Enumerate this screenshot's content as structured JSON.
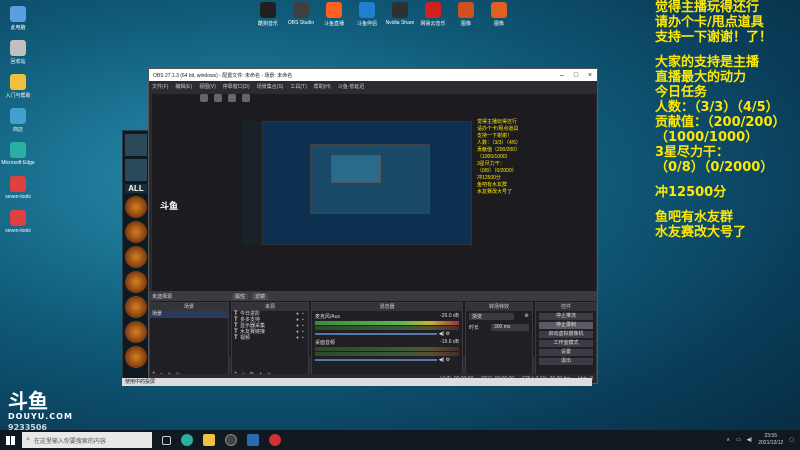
{
  "desktop": {
    "left_icons": [
      {
        "label": "此电脑",
        "color": "#5aa0e0"
      },
      {
        "label": "回收站",
        "color": "#c0c0c0"
      },
      {
        "label": "入门与帮助",
        "color": "#f0c040"
      },
      {
        "label": "商店",
        "color": "#40a0d0"
      },
      {
        "label": "Microsoft Edge",
        "color": "#2ab0a0"
      },
      {
        "label": "seven-tools",
        "color": "#e04040"
      },
      {
        "label": "seven-tools",
        "color": "#e04040"
      }
    ],
    "top_icons": [
      {
        "label": "酷狗音乐",
        "color": "#202020"
      },
      {
        "label": "OBS Studio",
        "color": "#404040"
      },
      {
        "label": "斗鱼直播",
        "color": "#ff6020"
      },
      {
        "label": "斗鱼伴侣",
        "color": "#2080d0"
      },
      {
        "label": "Nvidia Share",
        "color": "#303030"
      },
      {
        "label": "网易云音乐",
        "color": "#d02020"
      },
      {
        "label": "图像",
        "color": "#d05020"
      },
      {
        "label": "图像",
        "color": "#e06020"
      }
    ]
  },
  "overlay": {
    "lines": [
      "觉得主播玩得还行",
      "请办个卡/甩点道具",
      "支持一下谢谢！了！"
    ],
    "lines2": [
      "大家的支持是主播",
      "直播最大的动力",
      "今日任务",
      "人数：（3/3）（4/5）",
      "贡献值：（200/200）",
      "（1000/1000）",
      "3星尽力干：",
      "（0/8）（0/2000）"
    ],
    "line_chong": "冲12500分",
    "lines3": [
      "鱼吧有水友群",
      "水友赛改大号了"
    ]
  },
  "obs": {
    "title": "OBS 27.1.3 (64 bit, windows) - 配置文件: 未命名 - 场景: 未命名",
    "menu": [
      "文件(F)",
      "编辑(E)",
      "视图(V)",
      "停靠窗口(D)",
      "场景集合(S)",
      "工具(T)",
      "帮助(H)",
      "斗鱼-低延迟"
    ],
    "no_source": "未选择源",
    "props_label": "属性",
    "filters_label": "滤镜",
    "scenes_header": "场景",
    "scene_item": "场景",
    "sources_header": "来源",
    "sources": [
      "今日进阶",
      "多多支持",
      "显示器采集",
      "水友赛链接",
      "视频"
    ],
    "mixer_header": "混音器",
    "mixer": [
      {
        "name": "麦克风/Aux",
        "db": "-26.0 dB"
      },
      {
        "name": "桌面音频",
        "db": "-19.6 dB"
      }
    ],
    "transitions_header": "转场特效",
    "transition_type": "渐变",
    "duration_label": "时长",
    "duration_value": "300 ms",
    "controls_header": "控件",
    "controls": [
      "停止推流",
      "停止录制",
      "启动虚拟摄像机",
      "工作室模式",
      "设置",
      "退出"
    ],
    "status": {
      "live": "LIVE: 00:00:00",
      "rec": "REC: 00:00:00",
      "cpu": "CPU: 3.1%, 30.00 fps",
      "kb": "kb/s: 0"
    }
  },
  "preview": {
    "logo": "斗鱼",
    "texts": [
      "觉得主播玩得还行",
      "请办个卡/甩点道具",
      "支持一下谢谢！",
      "人数：（3/3）（4/5）",
      "贡献值（200/200）",
      "（1000/1000）",
      "3星尽力干：",
      "（0/8）（0/2000）",
      "冲12500分",
      "鱼吧有水友群",
      "水友赛改大号了"
    ]
  },
  "game_panel": {
    "all_label": "ALL"
  },
  "bottom_strip": "使用中的投屏",
  "douyu": {
    "logo_text": "斗鱼",
    "sub": "DOUYU.COM",
    "room": "9233506"
  },
  "taskbar": {
    "search_placeholder": "在这里输入你要搜索的内容",
    "time": "23:55",
    "date": "2021/12/12"
  }
}
